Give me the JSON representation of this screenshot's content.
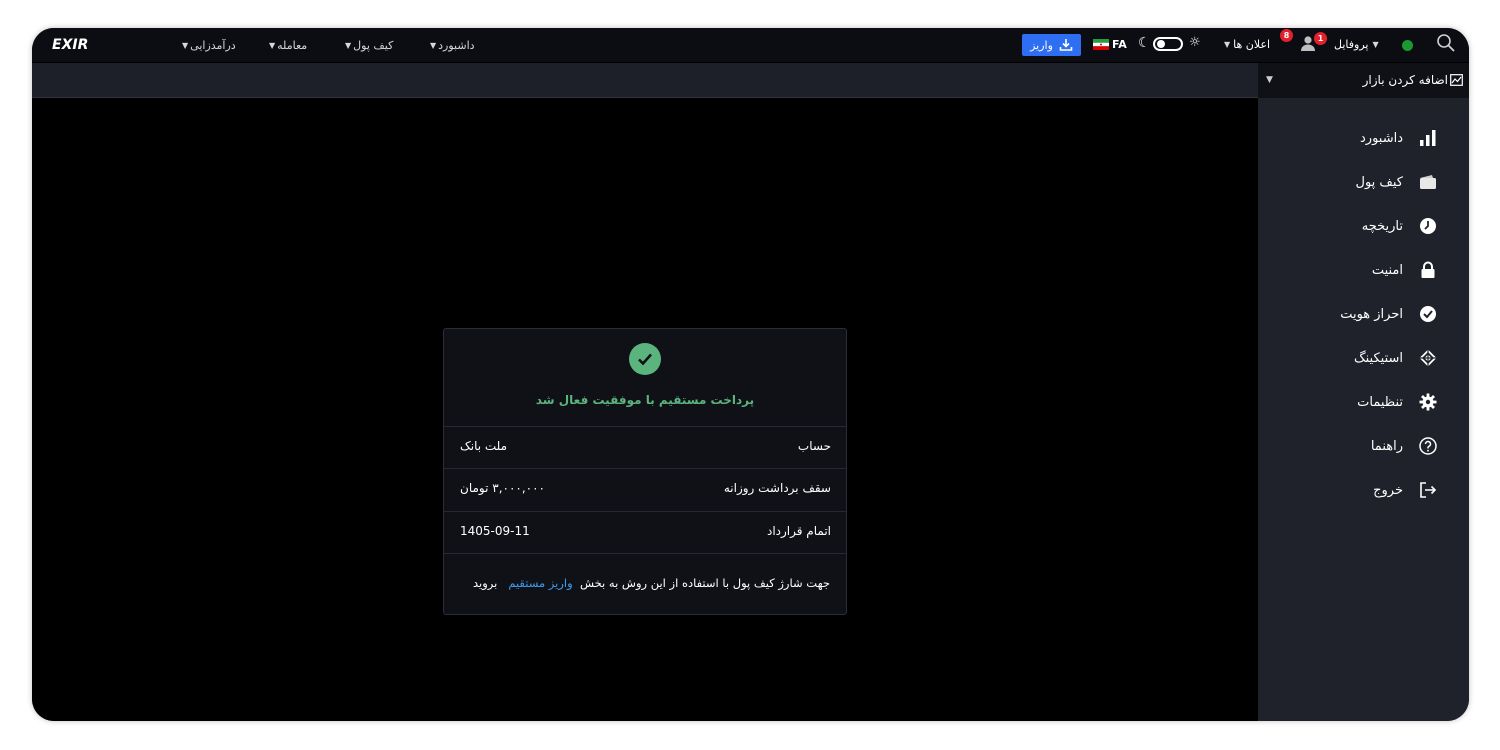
{
  "topbar": {
    "logo": "EXIR",
    "menus": [
      {
        "label": "درآمدزایی"
      },
      {
        "label": "معامله"
      },
      {
        "label": "کیف پول"
      },
      {
        "label": "داشبورد"
      }
    ],
    "deposit_label": "واریز",
    "lang": "FA",
    "announcements_label": "اعلان ها",
    "announcements_count": "8",
    "user_badge_count": "1",
    "profile_label": "پروفایل",
    "online_color": "#1a9a31"
  },
  "addmarket": {
    "label": "اضافه کردن بازار"
  },
  "sidebar": {
    "items": [
      {
        "label": "داشبورد",
        "icon": "bar-chart-icon"
      },
      {
        "label": "کیف پول",
        "icon": "wallet-icon"
      },
      {
        "label": "تاریخچه",
        "icon": "clock-icon"
      },
      {
        "label": "امنیت",
        "icon": "lock-icon"
      },
      {
        "label": "احراز هویت",
        "icon": "verified-icon"
      },
      {
        "label": "استیکینگ",
        "icon": "staking-icon"
      },
      {
        "label": "تنظیمات",
        "icon": "gear-icon"
      },
      {
        "label": "راهنما",
        "icon": "help-icon"
      },
      {
        "label": "خروج",
        "icon": "logout-icon"
      }
    ]
  },
  "card": {
    "success_text": "پرداخت مستقیم با موفقیت فعال شد",
    "rows": [
      {
        "label": "حساب",
        "value": "ملت بانک"
      },
      {
        "label": "سقف برداشت روزانه",
        "value": "۳,۰۰۰,۰۰۰ تومان"
      },
      {
        "label": "اتمام قرارداد",
        "value": "1405-09-11"
      }
    ],
    "note_prefix": "جهت شارژ کیف پول با استفاده از این روش به بخش",
    "note_link": "واریز مستقیم",
    "note_suffix": "بروید"
  },
  "colors": {
    "accent": "#2e6ef3",
    "success": "#5bb47e",
    "link": "#3c9cf0",
    "badge": "#e3202b"
  }
}
